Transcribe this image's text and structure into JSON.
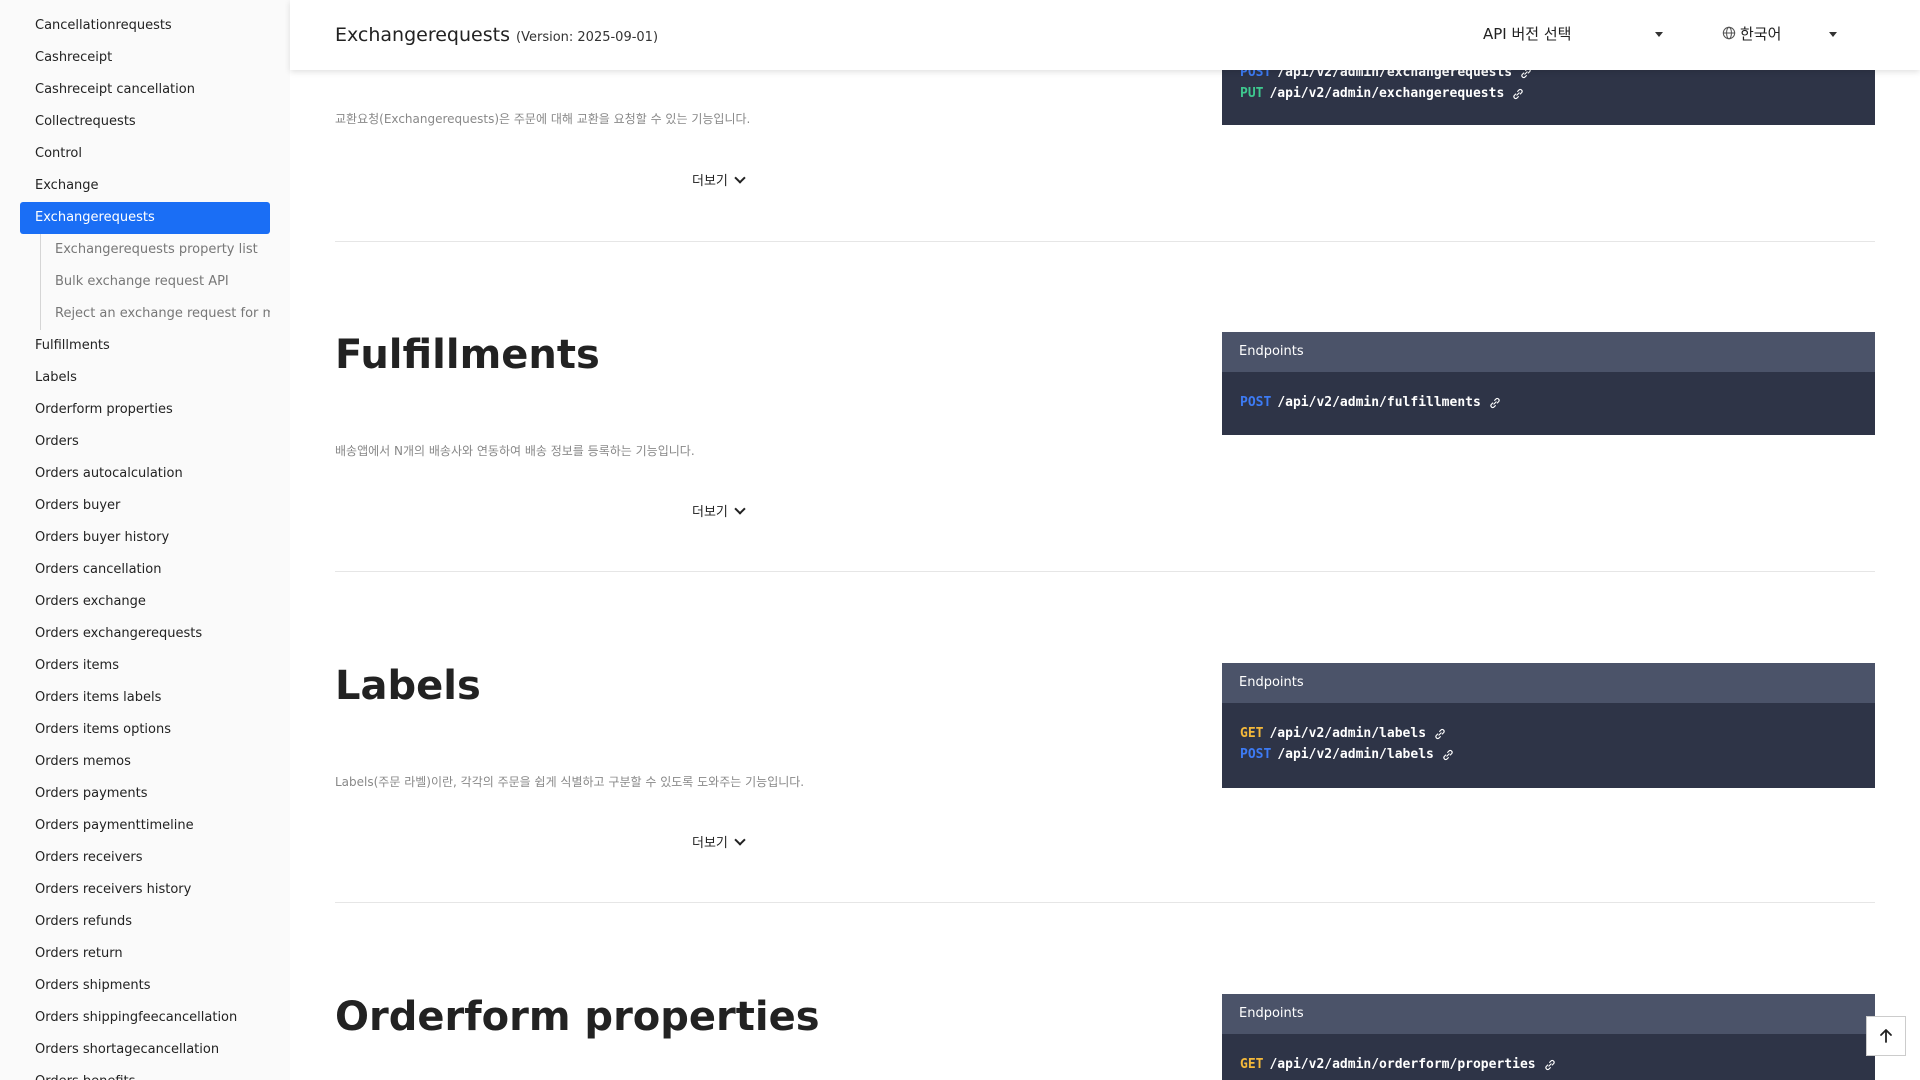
{
  "sidebar": {
    "items_before": [
      "Cancellationrequests",
      "Cashreceipt",
      "Cashreceipt cancellation",
      "Collectrequests",
      "Control",
      "Exchange"
    ],
    "active": "Exchangerequests",
    "sub_items": [
      "Exchangerequests property list",
      "Bulk exchange request API",
      "Reject an exchange request for multi"
    ],
    "items_after": [
      "Fulfillments",
      "Labels",
      "Orderform properties",
      "Orders",
      "Orders autocalculation",
      "Orders buyer",
      "Orders buyer history",
      "Orders cancellation",
      "Orders exchange",
      "Orders exchangerequests",
      "Orders items",
      "Orders items labels",
      "Orders items options",
      "Orders memos",
      "Orders payments",
      "Orders paymenttimeline",
      "Orders receivers",
      "Orders receivers history",
      "Orders refunds",
      "Orders return",
      "Orders shipments",
      "Orders shippingfeecancellation",
      "Orders shortagecancellation",
      "Orders benefits"
    ]
  },
  "header": {
    "title": "Exchangerequests",
    "version": "(Version: 2025-09-01)",
    "version_select_label": "API 버전 선택",
    "language_label": "한국어"
  },
  "sections": {
    "exchangerequests": {
      "desc": "교환요청(Exchangerequests)은 주문에 대해 교환을 요청할 수 있는 기능입니다.",
      "more": "더보기",
      "endpoints": [
        {
          "method": "POST",
          "path": "/api/v2/admin/exchangerequests"
        },
        {
          "method": "PUT",
          "path": "/api/v2/admin/exchangerequests"
        }
      ]
    },
    "fulfillments": {
      "title": "Fulfillments",
      "desc": "배송앱에서 N개의 배송사와 연동하여 배송 정보를 등록하는 기능입니다.",
      "more": "더보기",
      "endpoints_label": "Endpoints",
      "endpoints": [
        {
          "method": "POST",
          "path": "/api/v2/admin/fulfillments"
        }
      ]
    },
    "labels": {
      "title": "Labels",
      "desc": "Labels(주문 라벨)이란, 각각의 주문을 쉽게 식별하고 구분할 수 있도록 도와주는 기능입니다.",
      "more": "더보기",
      "endpoints_label": "Endpoints",
      "endpoints": [
        {
          "method": "GET",
          "path": "/api/v2/admin/labels"
        },
        {
          "method": "POST",
          "path": "/api/v2/admin/labels"
        }
      ]
    },
    "orderform_properties": {
      "title": "Orderform properties",
      "endpoints_label": "Endpoints",
      "endpoints": [
        {
          "method": "GET",
          "path": "/api/v2/admin/orderform/properties"
        }
      ]
    }
  },
  "colors": {
    "accent": "#1a6ef5",
    "get": "#f5b93a",
    "post": "#3d7bf5",
    "put": "#3ec98f",
    "endpoint_bg": "#2e3447",
    "endpoint_header": "#4b5369"
  },
  "icons": {
    "link": "link-icon",
    "globe": "globe-icon",
    "scroll_top": "arrow-up-icon"
  }
}
